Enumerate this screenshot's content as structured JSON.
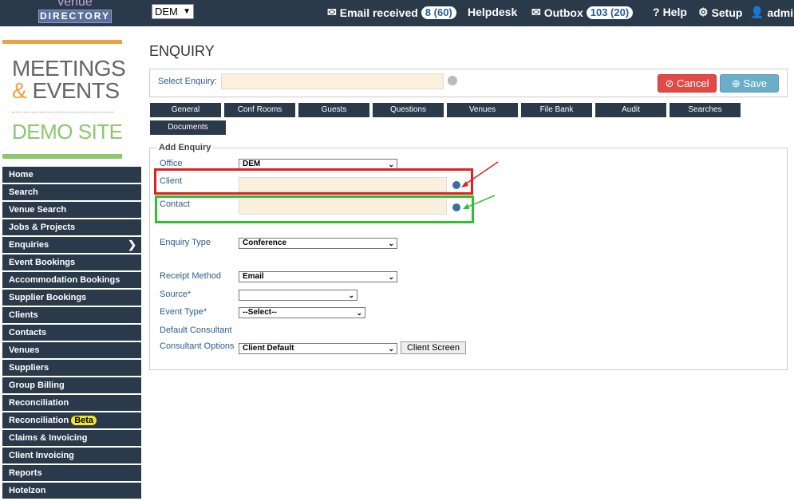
{
  "header": {
    "logo_top": "venue",
    "logo_bottom": "DIRECTORY",
    "office_value": "DEM",
    "email_label": "Email received",
    "email_count": "8 (60)",
    "helpdesk_label": "Helpdesk",
    "outbox_label": "Outbox",
    "outbox_count": "103 (20)",
    "help_label": "Help",
    "setup_label": "Setup",
    "admin_label": "admin"
  },
  "brand": {
    "line1": "MEETINGS",
    "amp": "&",
    "line2": "EVENTS",
    "line3": "DEMO SITE"
  },
  "nav": {
    "items": [
      "Home",
      "Search",
      "Venue Search",
      "Jobs & Projects",
      "Enquiries",
      "Event Bookings",
      "Accommodation Bookings",
      "Supplier Bookings",
      "Clients",
      "Contacts",
      "Venues",
      "Suppliers",
      "Group Billing",
      "Reconciliation",
      "Reconciliation",
      "Claims & Invoicing",
      "Client Invoicing",
      "Reports",
      "Hotelzon"
    ],
    "active_index": 4,
    "beta_label": "Beta"
  },
  "page": {
    "title": "ENQUIRY",
    "select_label": "Select Enquiry:",
    "cancel_label": "Cancel",
    "save_label": "Save"
  },
  "tabs": [
    "General",
    "Conf Rooms",
    "Guests",
    "Questions",
    "Venues",
    "File Bank",
    "Audit",
    "Searches",
    "Documents"
  ],
  "form": {
    "legend": "Add Enquiry",
    "office_label": "Office",
    "office_value": "DEM",
    "client_label": "Client",
    "contact_label": "Contact",
    "enquiry_type_label": "Enquiry Type",
    "enquiry_type_value": "Conference",
    "receipt_label": "Receipt Method",
    "receipt_value": "Email",
    "source_label": "Source*",
    "source_value": "",
    "event_type_label": "Event Type*",
    "event_type_value": "--Select--",
    "default_consultant_label": "Default Consultant",
    "consultant_options_label": "Consultant Options",
    "consultant_options_value": "Client Default",
    "client_screen_label": "Client Screen"
  },
  "colors": {
    "navbar": "#2b3a4a",
    "accent_orange": "#f0a040",
    "accent_green": "#8cc66d",
    "highlight_red": "#e02020",
    "highlight_green": "#2ec12e"
  }
}
